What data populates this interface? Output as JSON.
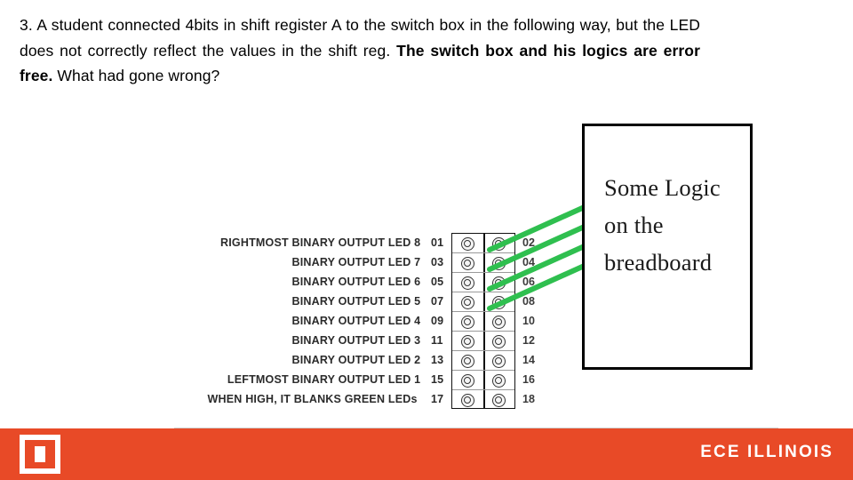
{
  "question": {
    "part1": "3. A student connected 4bits in shift register A to the switch box in the following way, but the LED does not correctly reflect the values in the shift reg. ",
    "emphasis": "The switch box and his logics are error free.",
    "part2": " What had gone wrong?"
  },
  "diagram": {
    "rows": [
      {
        "name": "RIGHTMOST BINARY OUTPUT",
        "led": "LED 8",
        "pin_left": "01",
        "pin_right": "02"
      },
      {
        "name": "BINARY OUTPUT",
        "led": "LED 7",
        "pin_left": "03",
        "pin_right": "04"
      },
      {
        "name": "BINARY OUTPUT",
        "led": "LED 6",
        "pin_left": "05",
        "pin_right": "06"
      },
      {
        "name": "BINARY OUTPUT",
        "led": "LED 5",
        "pin_left": "07",
        "pin_right": "08"
      },
      {
        "name": "BINARY OUTPUT",
        "led": "LED 4",
        "pin_left": "09",
        "pin_right": "10"
      },
      {
        "name": "BINARY OUTPUT",
        "led": "LED 3",
        "pin_left": "11",
        "pin_right": "12"
      },
      {
        "name": "BINARY OUTPUT",
        "led": "LED 2",
        "pin_left": "13",
        "pin_right": "14"
      },
      {
        "name": "LEFTMOST BINARY OUTPUT",
        "led": "LED 1",
        "pin_left": "15",
        "pin_right": "16"
      },
      {
        "name": "WHEN HIGH, IT BLANKS GREEN LEDs",
        "led": "",
        "pin_left": "17",
        "pin_right": "18"
      }
    ]
  },
  "logic_box": {
    "line1": "Some Logic",
    "line2": "on the",
    "line3": "breadboard"
  },
  "wires": {
    "color": "#2fbf4f",
    "count": 4
  },
  "footer": {
    "brand": "ECE ILLINOIS",
    "accent_color": "#e84a27",
    "logo_name": "block-i-logo"
  }
}
